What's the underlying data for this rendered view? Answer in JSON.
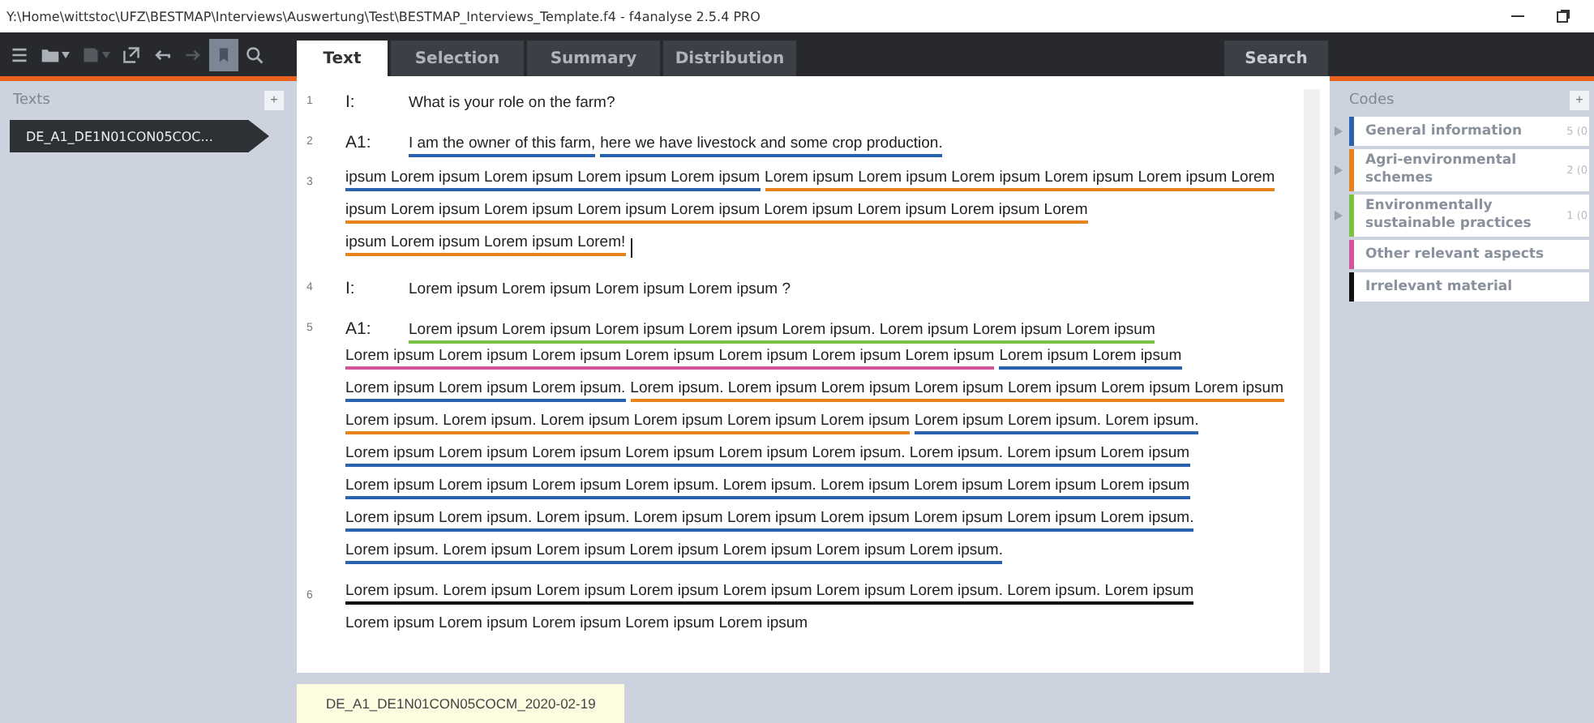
{
  "window": {
    "title": "Y:\\Home\\wittstoc\\UFZ\\BESTMAP\\Interviews\\Auswertung\\Test\\BESTMAP_Interviews_Template.f4 - f4analyse 2.5.4 PRO"
  },
  "toolbar": [
    {
      "kind": "menu",
      "disabled": false,
      "selected": false,
      "dropdown": false
    },
    {
      "kind": "folder",
      "disabled": false,
      "selected": false,
      "dropdown": true
    },
    {
      "kind": "save",
      "disabled": true,
      "selected": false,
      "dropdown": true
    },
    {
      "kind": "export",
      "disabled": false,
      "selected": false,
      "dropdown": false
    },
    {
      "kind": "undo",
      "disabled": false,
      "selected": false,
      "dropdown": false
    },
    {
      "kind": "redo",
      "disabled": true,
      "selected": false,
      "dropdown": false
    },
    {
      "kind": "bookmark",
      "disabled": false,
      "selected": true,
      "dropdown": false
    },
    {
      "kind": "search",
      "disabled": false,
      "selected": false,
      "dropdown": false
    }
  ],
  "tabs": [
    {
      "label": "Text",
      "selected": true
    },
    {
      "label": "Selection",
      "selected": false
    },
    {
      "label": "Summary",
      "selected": false
    },
    {
      "label": "Distribution",
      "selected": false
    }
  ],
  "search_tab": {
    "label": "Search"
  },
  "texts_panel": {
    "title": "Texts",
    "add": "+",
    "items": [
      {
        "label": "DE_A1_DE1N01CON05COC...",
        "selected": true
      }
    ]
  },
  "paragraphs": [
    {
      "number": "1",
      "speaker": "I:",
      "caret": false,
      "lines": [
        [
          {
            "text": "What is your role on the farm?"
          }
        ]
      ]
    },
    {
      "number": "2",
      "speaker": "A1:",
      "caret": false,
      "lines": [
        [
          {
            "text": "I am the owner of this farm,",
            "color": "#2a62b0"
          },
          {
            "text": "here we have livestock and some crop production.",
            "color": "#2a62b0"
          }
        ]
      ]
    },
    {
      "number": "3",
      "caret": true,
      "lines": [
        [
          {
            "text": "ipsum Lorem ipsum Lorem ipsum Lorem ipsum Lorem ipsum",
            "color": "#2a62b0"
          },
          {
            "text": "Lorem ipsum Lorem ipsum Lorem ipsum Lorem ipsum Lorem ipsum Lorem",
            "color": "#e8821e"
          }
        ],
        [
          {
            "text": "ipsum Lorem ipsum Lorem ipsum Lorem ipsum Lorem ipsum Lorem ipsum Lorem ipsum Lorem ipsum Lorem",
            "color": "#e8821e"
          }
        ],
        [
          {
            "text": "ipsum Lorem ipsum Lorem ipsum Lorem!",
            "color": "#e8821e"
          }
        ]
      ]
    },
    {
      "number": "4",
      "speaker": "I:",
      "caret": false,
      "lines": [
        [
          {
            "text": "Lorem ipsum Lorem ipsum Lorem ipsum Lorem ipsum ?"
          }
        ]
      ]
    },
    {
      "number": "5",
      "speaker": "A1:",
      "caret": false,
      "lines": [
        [
          {
            "text": "Lorem ipsum Lorem ipsum Lorem ipsum Lorem ipsum Lorem ipsum. Lorem ipsum Lorem ipsum Lorem ipsum",
            "color": "#7cc242"
          }
        ],
        [
          {
            "text": "Lorem ipsum Lorem ipsum Lorem ipsum Lorem ipsum Lorem ipsum Lorem ipsum Lorem ipsum",
            "color": "#d2559c"
          },
          {
            "text": "Lorem ipsum Lorem ipsum",
            "color": "#2a62b0"
          }
        ],
        [
          {
            "text": "Lorem ipsum Lorem ipsum Lorem ipsum.",
            "color": "#2a62b0"
          },
          {
            "text": "Lorem ipsum. Lorem ipsum Lorem ipsum Lorem ipsum Lorem ipsum Lorem ipsum Lorem ipsum",
            "color": "#e8821e"
          }
        ],
        [
          {
            "text": "Lorem ipsum. Lorem ipsum. Lorem ipsum Lorem ipsum Lorem ipsum Lorem ipsum",
            "color": "#e8821e"
          },
          {
            "text": "Lorem ipsum Lorem ipsum. Lorem ipsum.",
            "color": "#2a62b0"
          }
        ],
        [
          {
            "text": "Lorem ipsum Lorem ipsum Lorem ipsum Lorem ipsum Lorem ipsum Lorem ipsum. Lorem ipsum. Lorem ipsum Lorem ipsum",
            "color": "#2a62b0"
          }
        ],
        [
          {
            "text": "Lorem ipsum Lorem ipsum Lorem ipsum Lorem ipsum. Lorem ipsum. Lorem ipsum Lorem ipsum Lorem ipsum Lorem ipsum",
            "color": "#2a62b0"
          }
        ],
        [
          {
            "text": "Lorem ipsum Lorem ipsum. Lorem ipsum. Lorem ipsum Lorem ipsum Lorem ipsum Lorem ipsum Lorem ipsum Lorem ipsum.",
            "color": "#2a62b0"
          }
        ],
        [
          {
            "text": "Lorem ipsum. Lorem ipsum Lorem ipsum Lorem ipsum Lorem ipsum Lorem ipsum Lorem ipsum.",
            "color": "#2a62b0"
          }
        ]
      ]
    },
    {
      "number": "6",
      "caret": false,
      "lines": [
        [
          {
            "text": "Lorem ipsum. Lorem ipsum Lorem ipsum Lorem ipsum Lorem ipsum Lorem ipsum Lorem ipsum. Lorem ipsum. Lorem ipsum",
            "color": "#111111"
          }
        ],
        [
          {
            "text": "Lorem ipsum Lorem ipsum Lorem ipsum Lorem ipsum Lorem ipsum"
          }
        ]
      ]
    }
  ],
  "document_tab": {
    "label": "DE_A1_DE1N01CON05COCM_2020-02-19"
  },
  "codes_panel": {
    "title": "Codes",
    "add": "+",
    "items": [
      {
        "label": "General information",
        "color": "#2a62b0",
        "expandable": true,
        "count": "5 (0"
      },
      {
        "label": "Agri-environmental schemes",
        "color": "#e8821e",
        "expandable": true,
        "count": "2 (0"
      },
      {
        "label": "Environmentally sustainable practices",
        "color": "#7cc242",
        "expandable": true,
        "count": "1 (0"
      },
      {
        "label": "Other relevant aspects",
        "color": "#d2559c",
        "expandable": false
      },
      {
        "label": "Irrelevant material",
        "color": "#111111",
        "expandable": false
      }
    ]
  }
}
